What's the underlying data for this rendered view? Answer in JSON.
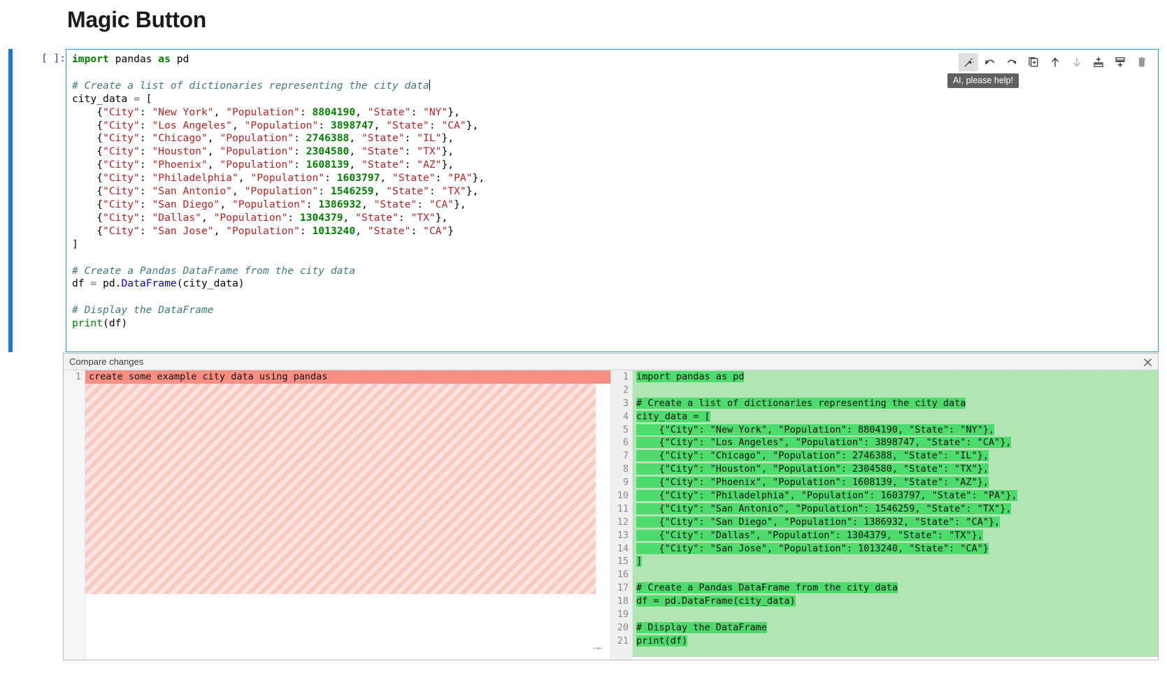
{
  "page": {
    "title": "Magic Button"
  },
  "cell": {
    "prompt": "[ ]:",
    "code_lines": [
      [
        {
          "t": "import",
          "c": "k"
        },
        {
          "t": " pandas ",
          "c": ""
        },
        {
          "t": "as",
          "c": "k"
        },
        {
          "t": " pd",
          "c": ""
        }
      ],
      [],
      [
        {
          "t": "# Create a list of dictionaries representing the city data",
          "c": "c"
        }
      ],
      [
        {
          "t": "city_data ",
          "c": ""
        },
        {
          "t": "=",
          "c": "op"
        },
        {
          "t": " [",
          "c": ""
        }
      ],
      [
        {
          "t": "    {",
          "c": ""
        },
        {
          "t": "\"City\"",
          "c": "s"
        },
        {
          "t": ": ",
          "c": ""
        },
        {
          "t": "\"New York\"",
          "c": "s"
        },
        {
          "t": ", ",
          "c": ""
        },
        {
          "t": "\"Population\"",
          "c": "s"
        },
        {
          "t": ": ",
          "c": ""
        },
        {
          "t": "8804190",
          "c": "n"
        },
        {
          "t": ", ",
          "c": ""
        },
        {
          "t": "\"State\"",
          "c": "s"
        },
        {
          "t": ": ",
          "c": ""
        },
        {
          "t": "\"NY\"",
          "c": "s"
        },
        {
          "t": "},",
          "c": ""
        }
      ],
      [
        {
          "t": "    {",
          "c": ""
        },
        {
          "t": "\"City\"",
          "c": "s"
        },
        {
          "t": ": ",
          "c": ""
        },
        {
          "t": "\"Los Angeles\"",
          "c": "s"
        },
        {
          "t": ", ",
          "c": ""
        },
        {
          "t": "\"Population\"",
          "c": "s"
        },
        {
          "t": ": ",
          "c": ""
        },
        {
          "t": "3898747",
          "c": "n"
        },
        {
          "t": ", ",
          "c": ""
        },
        {
          "t": "\"State\"",
          "c": "s"
        },
        {
          "t": ": ",
          "c": ""
        },
        {
          "t": "\"CA\"",
          "c": "s"
        },
        {
          "t": "},",
          "c": ""
        }
      ],
      [
        {
          "t": "    {",
          "c": ""
        },
        {
          "t": "\"City\"",
          "c": "s"
        },
        {
          "t": ": ",
          "c": ""
        },
        {
          "t": "\"Chicago\"",
          "c": "s"
        },
        {
          "t": ", ",
          "c": ""
        },
        {
          "t": "\"Population\"",
          "c": "s"
        },
        {
          "t": ": ",
          "c": ""
        },
        {
          "t": "2746388",
          "c": "n"
        },
        {
          "t": ", ",
          "c": ""
        },
        {
          "t": "\"State\"",
          "c": "s"
        },
        {
          "t": ": ",
          "c": ""
        },
        {
          "t": "\"IL\"",
          "c": "s"
        },
        {
          "t": "},",
          "c": ""
        }
      ],
      [
        {
          "t": "    {",
          "c": ""
        },
        {
          "t": "\"City\"",
          "c": "s"
        },
        {
          "t": ": ",
          "c": ""
        },
        {
          "t": "\"Houston\"",
          "c": "s"
        },
        {
          "t": ", ",
          "c": ""
        },
        {
          "t": "\"Population\"",
          "c": "s"
        },
        {
          "t": ": ",
          "c": ""
        },
        {
          "t": "2304580",
          "c": "n"
        },
        {
          "t": ", ",
          "c": ""
        },
        {
          "t": "\"State\"",
          "c": "s"
        },
        {
          "t": ": ",
          "c": ""
        },
        {
          "t": "\"TX\"",
          "c": "s"
        },
        {
          "t": "},",
          "c": ""
        }
      ],
      [
        {
          "t": "    {",
          "c": ""
        },
        {
          "t": "\"City\"",
          "c": "s"
        },
        {
          "t": ": ",
          "c": ""
        },
        {
          "t": "\"Phoenix\"",
          "c": "s"
        },
        {
          "t": ", ",
          "c": ""
        },
        {
          "t": "\"Population\"",
          "c": "s"
        },
        {
          "t": ": ",
          "c": ""
        },
        {
          "t": "1608139",
          "c": "n"
        },
        {
          "t": ", ",
          "c": ""
        },
        {
          "t": "\"State\"",
          "c": "s"
        },
        {
          "t": ": ",
          "c": ""
        },
        {
          "t": "\"AZ\"",
          "c": "s"
        },
        {
          "t": "},",
          "c": ""
        }
      ],
      [
        {
          "t": "    {",
          "c": ""
        },
        {
          "t": "\"City\"",
          "c": "s"
        },
        {
          "t": ": ",
          "c": ""
        },
        {
          "t": "\"Philadelphia\"",
          "c": "s"
        },
        {
          "t": ", ",
          "c": ""
        },
        {
          "t": "\"Population\"",
          "c": "s"
        },
        {
          "t": ": ",
          "c": ""
        },
        {
          "t": "1603797",
          "c": "n"
        },
        {
          "t": ", ",
          "c": ""
        },
        {
          "t": "\"State\"",
          "c": "s"
        },
        {
          "t": ": ",
          "c": ""
        },
        {
          "t": "\"PA\"",
          "c": "s"
        },
        {
          "t": "},",
          "c": ""
        }
      ],
      [
        {
          "t": "    {",
          "c": ""
        },
        {
          "t": "\"City\"",
          "c": "s"
        },
        {
          "t": ": ",
          "c": ""
        },
        {
          "t": "\"San Antonio\"",
          "c": "s"
        },
        {
          "t": ", ",
          "c": ""
        },
        {
          "t": "\"Population\"",
          "c": "s"
        },
        {
          "t": ": ",
          "c": ""
        },
        {
          "t": "1546259",
          "c": "n"
        },
        {
          "t": ", ",
          "c": ""
        },
        {
          "t": "\"State\"",
          "c": "s"
        },
        {
          "t": ": ",
          "c": ""
        },
        {
          "t": "\"TX\"",
          "c": "s"
        },
        {
          "t": "},",
          "c": ""
        }
      ],
      [
        {
          "t": "    {",
          "c": ""
        },
        {
          "t": "\"City\"",
          "c": "s"
        },
        {
          "t": ": ",
          "c": ""
        },
        {
          "t": "\"San Diego\"",
          "c": "s"
        },
        {
          "t": ", ",
          "c": ""
        },
        {
          "t": "\"Population\"",
          "c": "s"
        },
        {
          "t": ": ",
          "c": ""
        },
        {
          "t": "1386932",
          "c": "n"
        },
        {
          "t": ", ",
          "c": ""
        },
        {
          "t": "\"State\"",
          "c": "s"
        },
        {
          "t": ": ",
          "c": ""
        },
        {
          "t": "\"CA\"",
          "c": "s"
        },
        {
          "t": "},",
          "c": ""
        }
      ],
      [
        {
          "t": "    {",
          "c": ""
        },
        {
          "t": "\"City\"",
          "c": "s"
        },
        {
          "t": ": ",
          "c": ""
        },
        {
          "t": "\"Dallas\"",
          "c": "s"
        },
        {
          "t": ", ",
          "c": ""
        },
        {
          "t": "\"Population\"",
          "c": "s"
        },
        {
          "t": ": ",
          "c": ""
        },
        {
          "t": "1304379",
          "c": "n"
        },
        {
          "t": ", ",
          "c": ""
        },
        {
          "t": "\"State\"",
          "c": "s"
        },
        {
          "t": ": ",
          "c": ""
        },
        {
          "t": "\"TX\"",
          "c": "s"
        },
        {
          "t": "},",
          "c": ""
        }
      ],
      [
        {
          "t": "    {",
          "c": ""
        },
        {
          "t": "\"City\"",
          "c": "s"
        },
        {
          "t": ": ",
          "c": ""
        },
        {
          "t": "\"San Jose\"",
          "c": "s"
        },
        {
          "t": ", ",
          "c": ""
        },
        {
          "t": "\"Population\"",
          "c": "s"
        },
        {
          "t": ": ",
          "c": ""
        },
        {
          "t": "1013240",
          "c": "n"
        },
        {
          "t": ", ",
          "c": ""
        },
        {
          "t": "\"State\"",
          "c": "s"
        },
        {
          "t": ": ",
          "c": ""
        },
        {
          "t": "\"CA\"",
          "c": "s"
        },
        {
          "t": "}",
          "c": ""
        }
      ],
      [
        {
          "t": "]",
          "c": ""
        }
      ],
      [],
      [
        {
          "t": "# Create a Pandas DataFrame from the city data",
          "c": "c"
        }
      ],
      [
        {
          "t": "df ",
          "c": ""
        },
        {
          "t": "=",
          "c": "op"
        },
        {
          "t": " pd.",
          "c": ""
        },
        {
          "t": "DataFrame",
          "c": "cls"
        },
        {
          "t": "(city_data)",
          "c": ""
        }
      ],
      [],
      [
        {
          "t": "# Display the DataFrame",
          "c": "c"
        }
      ],
      [
        {
          "t": "print",
          "c": "bi"
        },
        {
          "t": "(df)",
          "c": ""
        }
      ]
    ],
    "caret_line": 2,
    "toolbar": {
      "buttons": [
        {
          "name": "magic-wand-icon",
          "label": "AI, please help!",
          "active": true
        },
        {
          "name": "undo-icon",
          "label": "Undo",
          "active": false
        },
        {
          "name": "redo-icon",
          "label": "Redo",
          "active": false
        },
        {
          "name": "duplicate-cell-icon",
          "label": "Duplicate cell",
          "active": false
        },
        {
          "name": "move-cell-up-icon",
          "label": "Move cell up",
          "active": false
        },
        {
          "name": "move-cell-down-icon",
          "label": "Move cell down",
          "active": false
        },
        {
          "name": "insert-cell-above-icon",
          "label": "Insert cell above",
          "active": false
        },
        {
          "name": "insert-cell-below-icon",
          "label": "Insert cell below",
          "active": false
        },
        {
          "name": "delete-cell-icon",
          "label": "Delete cell",
          "active": false
        }
      ],
      "tooltip": "AI, please help!"
    }
  },
  "diff": {
    "header_title": "Compare changes",
    "close_label": "×",
    "left": {
      "line_numbers": [
        "1"
      ],
      "lines": [
        "create some example city data using pandas"
      ]
    },
    "right": {
      "line_numbers": [
        "1",
        "2",
        "3",
        "4",
        "5",
        "6",
        "7",
        "8",
        "9",
        "10",
        "11",
        "12",
        "13",
        "14",
        "15",
        "16",
        "17",
        "18",
        "19",
        "20",
        "21"
      ],
      "lines": [
        "import pandas as pd",
        "",
        "# Create a list of dictionaries representing the city data",
        "city_data = [",
        "    {\"City\": \"New York\", \"Population\": 8804190, \"State\": \"NY\"},",
        "    {\"City\": \"Los Angeles\", \"Population\": 3898747, \"State\": \"CA\"},",
        "    {\"City\": \"Chicago\", \"Population\": 2746388, \"State\": \"IL\"},",
        "    {\"City\": \"Houston\", \"Population\": 2304580, \"State\": \"TX\"},",
        "    {\"City\": \"Phoenix\", \"Population\": 1608139, \"State\": \"AZ\"},",
        "    {\"City\": \"Philadelphia\", \"Population\": 1603797, \"State\": \"PA\"},",
        "    {\"City\": \"San Antonio\", \"Population\": 1546259, \"State\": \"TX\"},",
        "    {\"City\": \"San Diego\", \"Population\": 1386932, \"State\": \"CA\"},",
        "    {\"City\": \"Dallas\", \"Population\": 1304379, \"State\": \"TX\"},",
        "    {\"City\": \"San Jose\", \"Population\": 1013240, \"State\": \"CA\"}",
        "]",
        "",
        "# Create a Pandas DataFrame from the city data",
        "df = pd.DataFrame(city_data)",
        "",
        "# Display the DataFrame",
        "print(df)"
      ]
    },
    "collapse_handle": "―←"
  },
  "colors": {
    "accent": "#1976d2",
    "cell_border": "#2196c8",
    "added_bg": "#b3e6b5",
    "added_word": "#4ddc6b",
    "deleted_bg": "#f98e83",
    "deleted_fill": "#f9c9c2",
    "tooltip_bg": "#616161"
  }
}
